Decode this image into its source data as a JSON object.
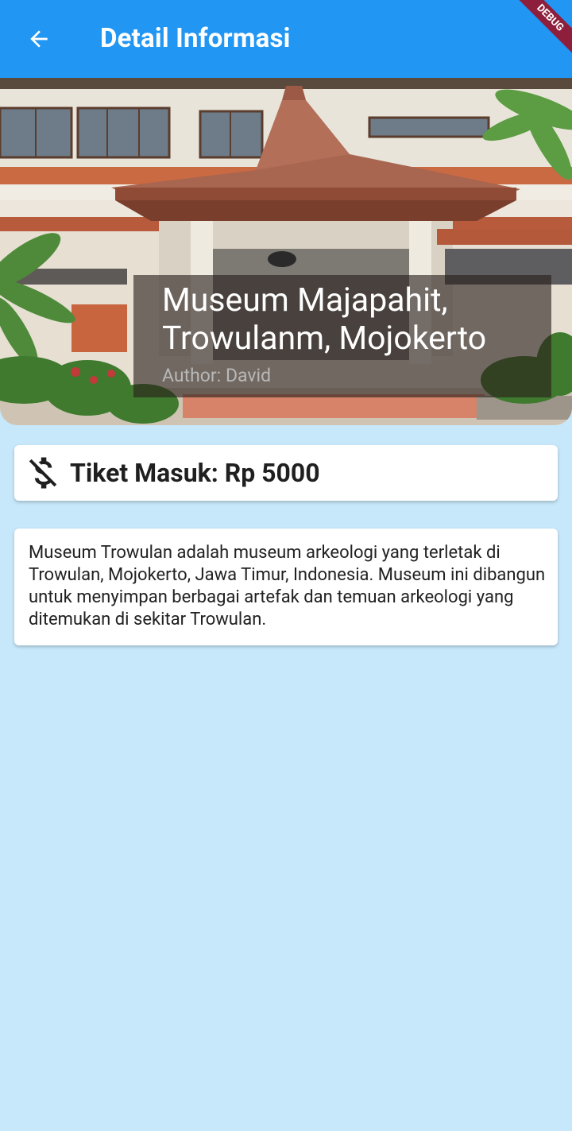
{
  "appbar": {
    "title": "Detail Informasi",
    "back_icon": "arrow-back-icon",
    "background_color": "#2196f3",
    "debug_banner": "DEBUG"
  },
  "hero": {
    "title": "Museum Majapahit, Trowulanm, Mojokerto",
    "author": "Author: David"
  },
  "ticket": {
    "icon": "money-off-icon",
    "label": "Tiket Masuk: Rp 5000"
  },
  "description": {
    "text": "Museum Trowulan adalah museum arkeologi yang terletak di Trowulan, Mojokerto, Jawa Timur, Indonesia. Museum ini dibangun untuk menyimpan berbagai artefak dan temuan arkeologi yang ditemukan di sekitar Trowulan."
  },
  "colors": {
    "page_background": "#c7e8fb",
    "card_background": "#ffffff"
  }
}
